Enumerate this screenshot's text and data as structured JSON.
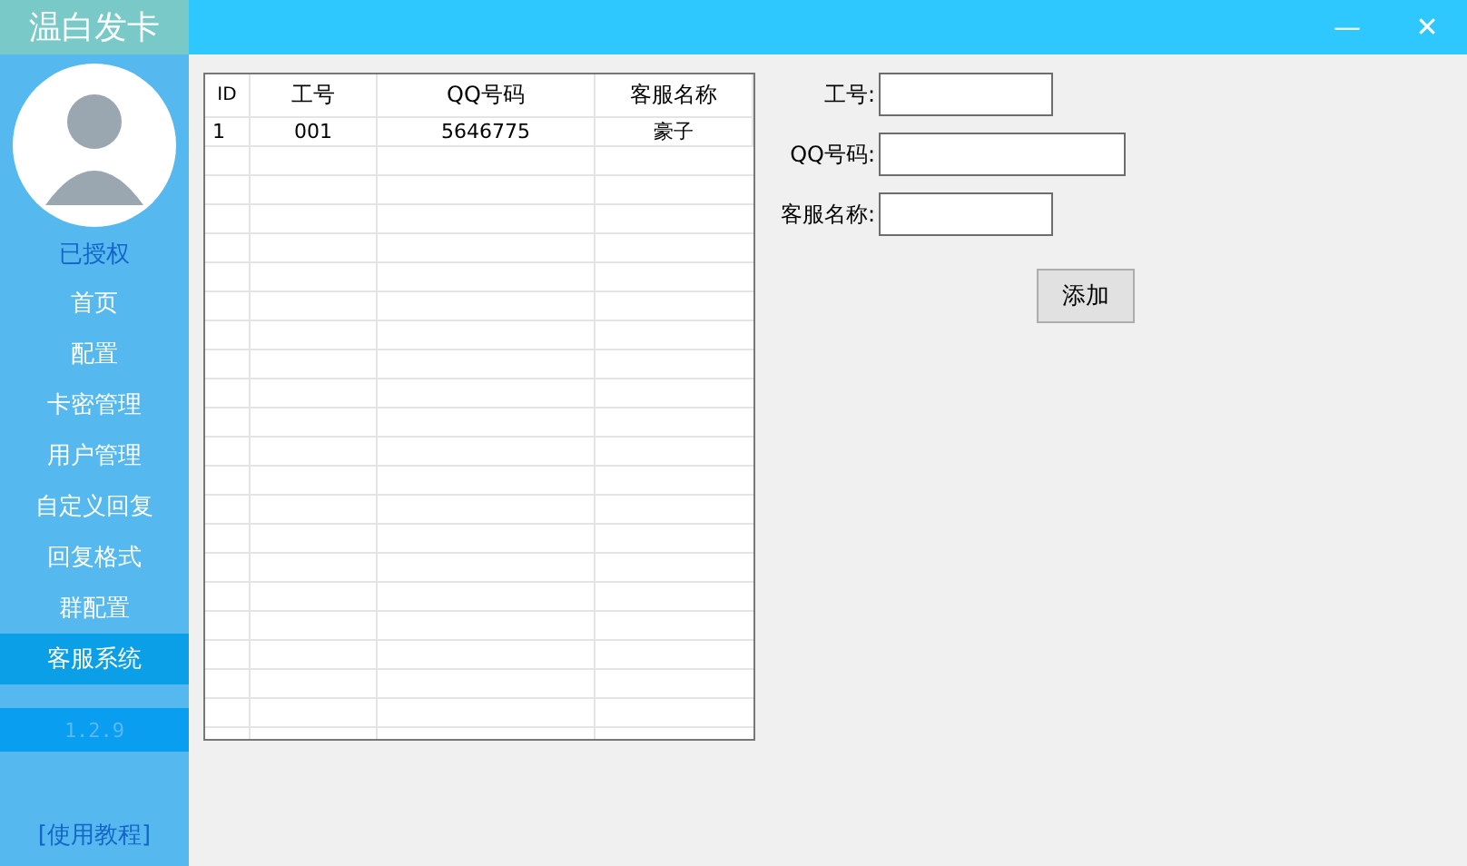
{
  "window": {
    "title": "温白发卡",
    "controls": [
      "—",
      "✕"
    ]
  },
  "sidebar": {
    "status": "已授权",
    "items": [
      {
        "label": "首页",
        "selected": false
      },
      {
        "label": "配置",
        "selected": false
      },
      {
        "label": "卡密管理",
        "selected": false
      },
      {
        "label": "用户管理",
        "selected": false
      },
      {
        "label": "自定义回复",
        "selected": false
      },
      {
        "label": "回复格式",
        "selected": false
      },
      {
        "label": "群配置",
        "selected": false
      },
      {
        "label": "客服系统",
        "selected": true
      }
    ],
    "version": "1.2.9",
    "help_link": "[使用教程]"
  },
  "table": {
    "columns": [
      "ID",
      "工号",
      "QQ号码",
      "客服名称"
    ],
    "rows": [
      [
        "1",
        "001",
        "5646775",
        "豪子"
      ]
    ]
  },
  "form": {
    "fields": [
      {
        "label": "工号:"
      },
      {
        "label": "QQ号码:"
      },
      {
        "label": "客服名称:"
      }
    ],
    "button": "添加"
  }
}
